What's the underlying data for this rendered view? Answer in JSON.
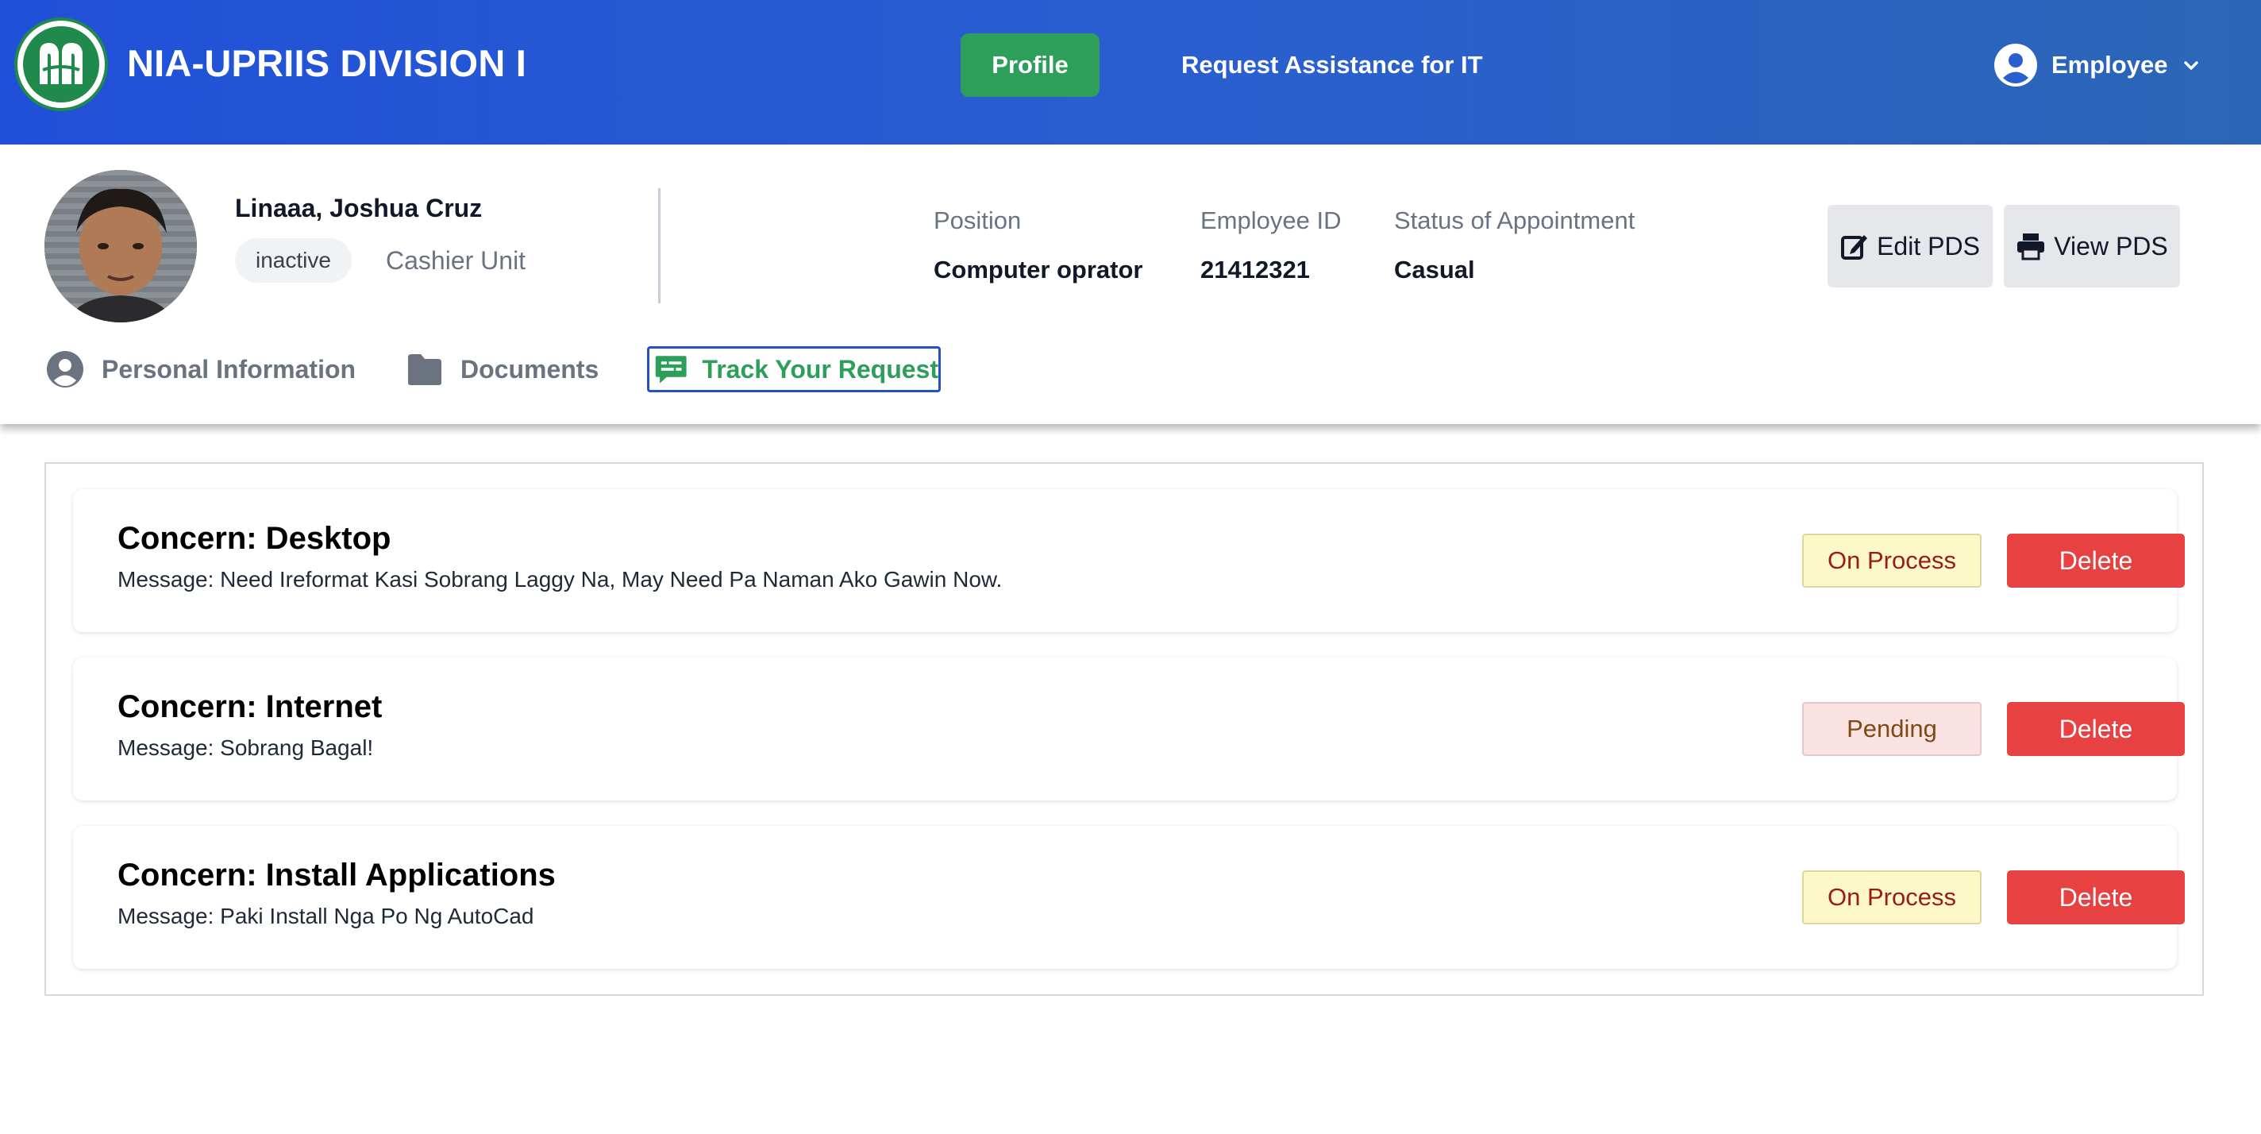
{
  "navbar": {
    "brand": "NIA-UPRIIS DIVISION I",
    "profile_label": "Profile",
    "request_label": "Request Assistance for IT",
    "user_label": "Employee",
    "user_icon": "user-circle-icon",
    "dropdown_icon": "chevron-down-icon",
    "accent_color": "#2e9e5b",
    "bar_color": "#2150d8"
  },
  "profile": {
    "name": "Linaaa, Joshua Cruz",
    "status": "inactive",
    "unit": "Cashier Unit",
    "fields": [
      {
        "label": "Position",
        "value": "Computer oprator"
      },
      {
        "label": "Employee ID",
        "value": "21412321"
      },
      {
        "label": "Status of Appointment",
        "value": "Casual"
      }
    ],
    "edit_pds": "Edit PDS",
    "view_pds": "View PDS"
  },
  "tabs": [
    {
      "label": "Personal Information",
      "icon": "user-circle-icon",
      "active": false
    },
    {
      "label": "Documents",
      "icon": "folder-icon",
      "active": false
    },
    {
      "label": "Track Your Request",
      "icon": "chat-message-icon",
      "active": true
    }
  ],
  "requests": [
    {
      "concern": "Concern: Desktop",
      "message": "Message: Need Ireformat Kasi Sobrang Laggy Na, May Need Pa Naman Ako Gawin Now.",
      "status": "On Process",
      "action": "Delete"
    },
    {
      "concern": "Concern: Internet",
      "message": "Message: Sobrang Bagal!",
      "status": "Pending",
      "action": "Delete"
    },
    {
      "concern": "Concern: Install Applications",
      "message": "Message: Paki Install Nga Po Ng AutoCad",
      "status": "On Process",
      "action": "Delete"
    }
  ],
  "colors": {
    "delete": "#e84141",
    "on_process_bg": "#fdf8c7",
    "pending_bg": "#fbe2e2"
  }
}
